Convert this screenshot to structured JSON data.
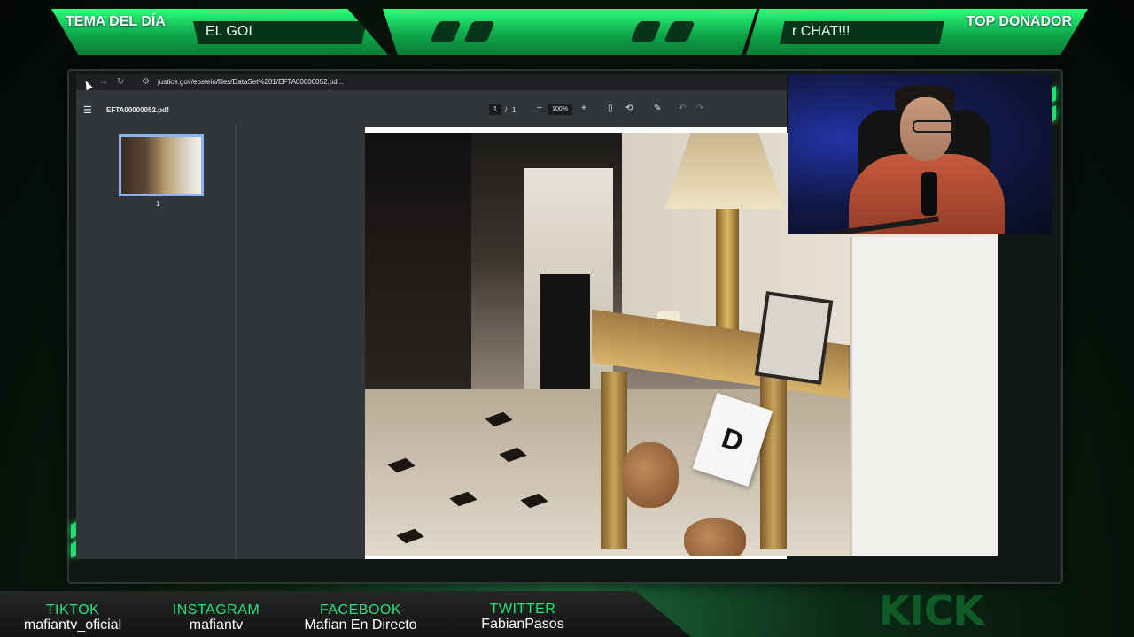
{
  "overlay": {
    "left_title": "TEMA DEL DÍA",
    "left_value": "EL GOI",
    "right_title": "TOP DONADOR",
    "right_value": "r CHAT!!!"
  },
  "browser": {
    "url": "justice.gov/epstein/files/DataSet%201/EFTA00000052.pd...",
    "back_icon": "back-arrow-icon",
    "forward_icon": "forward-arrow-icon",
    "reload_icon": "reload-icon"
  },
  "pdf_viewer": {
    "file_name": "EFTA00000052.pdf",
    "current_page": "1",
    "page_separator": "/",
    "total_pages": "1",
    "zoom": "100%",
    "thumbnail_label": "1"
  },
  "evidence_marker": "D",
  "socials": [
    {
      "platform": "TIKTOK",
      "handle": "mafiantv_oficial"
    },
    {
      "platform": "INSTAGRAM",
      "handle": "mafiantv"
    },
    {
      "platform": "FACEBOOK",
      "handle": "Mafian En Directo"
    },
    {
      "platform": "TWITTER",
      "handle": "FabianPasos"
    }
  ],
  "brand": {
    "kick_logo": "KICK",
    "accent_color": "#29e07a"
  }
}
